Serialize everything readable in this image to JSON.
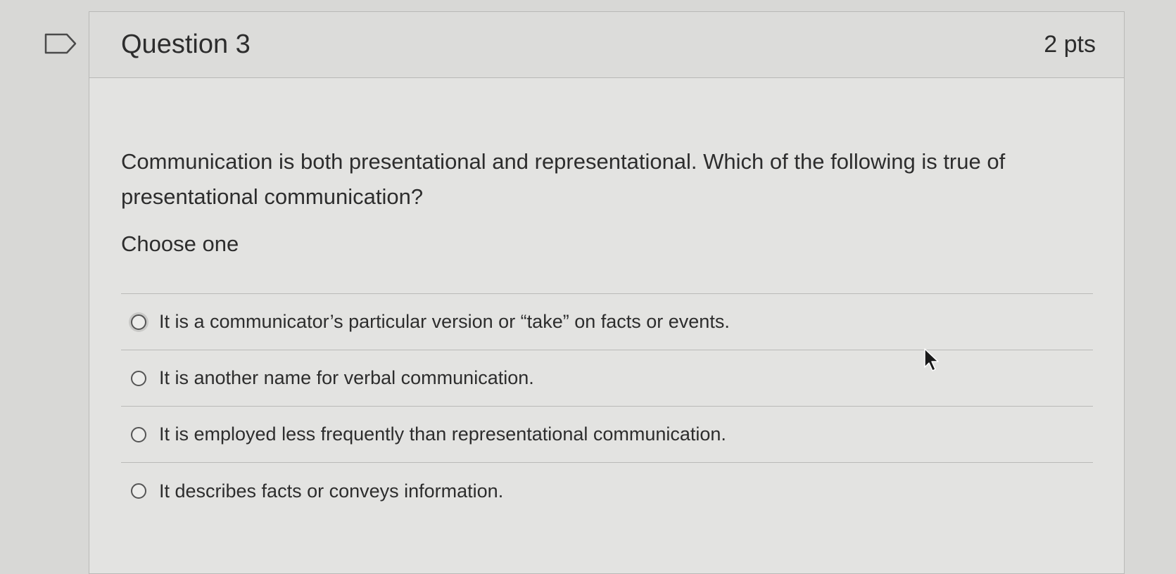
{
  "question": {
    "title": "Question 3",
    "points": "2 pts",
    "text": "Communication is both presentational and representational. Which of the following is true of presentational communication?",
    "instruction": "Choose one",
    "answers": [
      {
        "label": "It is a communicator’s particular version or “take” on facts or events."
      },
      {
        "label": "It is another name for verbal communication."
      },
      {
        "label": "It is employed less frequently than representational communication."
      },
      {
        "label": "It describes facts or conveys information."
      }
    ]
  },
  "icons": {
    "flag": "flag-question-icon",
    "radio": "radio-button-icon",
    "cursor": "mouse-pointer-icon"
  }
}
